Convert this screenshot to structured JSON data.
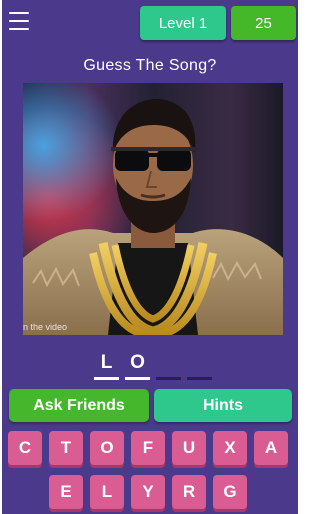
{
  "header": {
    "menu_icon": "hamburger-menu-icon",
    "level_label": "Level 1",
    "score": "25"
  },
  "question": "Guess The Song?",
  "image": {
    "caption": "n the video"
  },
  "answer": {
    "letters": [
      "L",
      "O",
      "",
      ""
    ]
  },
  "actions": {
    "ask_friends": "Ask Friends",
    "hints": "Hints"
  },
  "keyboard": {
    "row1": [
      "C",
      "T",
      "O",
      "F",
      "U",
      "X",
      "A"
    ],
    "row2": [
      "E",
      "L",
      "Y",
      "R",
      "G"
    ]
  },
  "colors": {
    "background": "#4b3a8c",
    "level_badge": "#2ec78c",
    "score_badge": "#44b829",
    "ask_button": "#45b72c",
    "hints_button": "#2ec78c",
    "key": "#d95c92"
  }
}
